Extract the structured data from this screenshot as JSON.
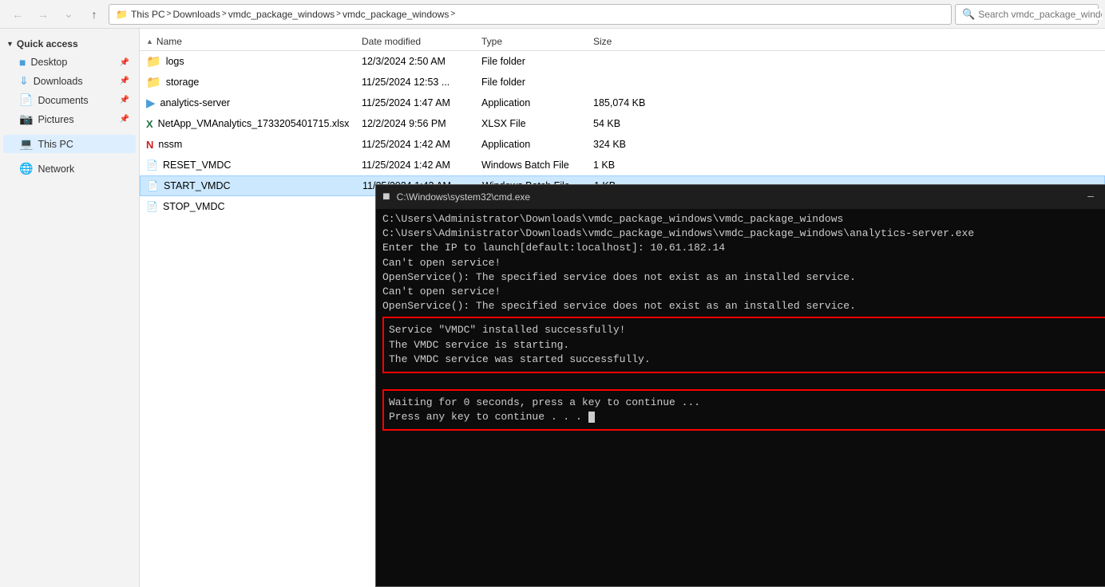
{
  "topbar": {
    "back_btn": "←",
    "forward_btn": "→",
    "up_btn": "↑",
    "address": {
      "parts": [
        "This PC",
        "Downloads",
        "vmdc_package_windows",
        "vmdc_package_windows"
      ]
    },
    "search_placeholder": "Search vmdc_package_windows"
  },
  "sidebar": {
    "quick_access_label": "Quick access",
    "items": [
      {
        "id": "desktop",
        "label": "Desktop",
        "icon": "📋",
        "pinned": true
      },
      {
        "id": "downloads",
        "label": "Downloads",
        "icon": "⬇",
        "pinned": true
      },
      {
        "id": "documents",
        "label": "Documents",
        "icon": "📄",
        "pinned": true
      },
      {
        "id": "pictures",
        "label": "Pictures",
        "icon": "🖼",
        "pinned": true
      },
      {
        "id": "thispc",
        "label": "This PC",
        "icon": "💻",
        "active": true
      },
      {
        "id": "network",
        "label": "Network",
        "icon": "🌐"
      }
    ]
  },
  "file_list": {
    "columns": {
      "name": "Name",
      "date_modified": "Date modified",
      "type": "Type",
      "size": "Size"
    },
    "sort_col": "name",
    "rows": [
      {
        "name": "logs",
        "date": "12/3/2024 2:50 AM",
        "type": "File folder",
        "size": "",
        "icon_type": "folder"
      },
      {
        "name": "storage",
        "date": "11/25/2024 12:53 ...",
        "type": "File folder",
        "size": "",
        "icon_type": "folder"
      },
      {
        "name": "analytics-server",
        "date": "11/25/2024 1:47 AM",
        "type": "Application",
        "size": "185,074 KB",
        "icon_type": "app"
      },
      {
        "name": "NetApp_VMAnalytics_1733205401715.xlsx",
        "date": "12/2/2024 9:56 PM",
        "type": "XLSX File",
        "size": "54 KB",
        "icon_type": "excel"
      },
      {
        "name": "nssm",
        "date": "11/25/2024 1:42 AM",
        "type": "Application",
        "size": "324 KB",
        "icon_type": "nssm"
      },
      {
        "name": "RESET_VMDC",
        "date": "11/25/2024 1:42 AM",
        "type": "Windows Batch File",
        "size": "1 KB",
        "icon_type": "bat"
      },
      {
        "name": "START_VMDC",
        "date": "11/25/2024 1:42 AM",
        "type": "Windows Batch File",
        "size": "1 KB",
        "icon_type": "bat",
        "selected": true
      },
      {
        "name": "STOP_VMDC",
        "date": "",
        "type": "",
        "size": "",
        "icon_type": "bat"
      }
    ]
  },
  "cmd": {
    "title": "C:\\Windows\\system32\\cmd.exe",
    "icon": "▪",
    "lines_before": [
      "C:\\Users\\Administrator\\Downloads\\vmdc_package_windows\\vmdc_package_windows",
      "C:\\Users\\Administrator\\Downloads\\vmdc_package_windows\\vmdc_package_windows\\analytics-server.exe",
      "Enter the IP to launch[default:localhost]: 10.61.182.14",
      "Can't open service!",
      "OpenService(): The specified service does not exist as an installed service.",
      "",
      "Can't open service!",
      "OpenService(): The specified service does not exist as an installed service."
    ],
    "section1": [
      "Service \"VMDC\" installed successfully!",
      "The VMDC service is starting.",
      "The VMDC service was started successfully."
    ],
    "section2": [
      "Waiting for 0 seconds, press a key to continue ...",
      "Press any key to continue . . . _"
    ],
    "minimize_label": "─",
    "maximize_label": "□",
    "close_label": "✕"
  }
}
